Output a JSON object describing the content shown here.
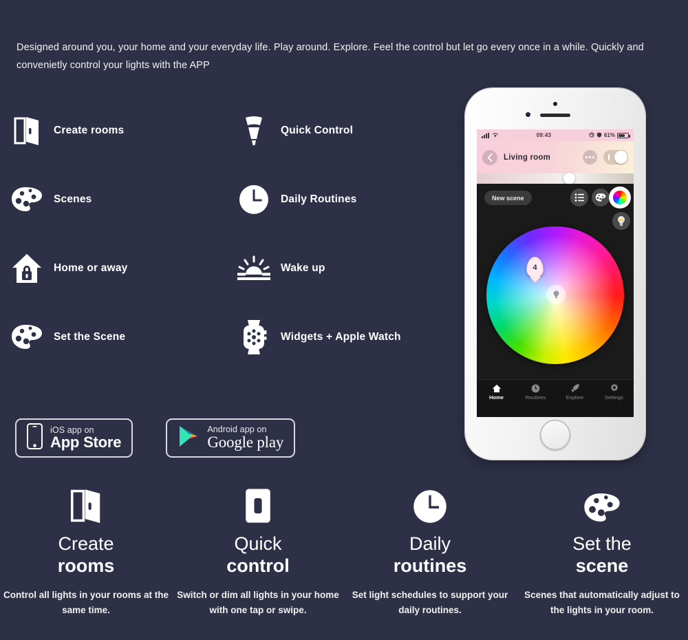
{
  "intro": {
    "text": "Designed around you, your home and your everyday life. Play around. Explore. Feel the control but let go every once in a while. Quickly and convenietly control your lights with the  APP"
  },
  "features": [
    {
      "icon": "open-door-icon",
      "label": "Create rooms"
    },
    {
      "icon": "spotlight-bulb-icon",
      "label": "Quick Control"
    },
    {
      "icon": "palette-icon",
      "label": "Scenes"
    },
    {
      "icon": "clock-icon",
      "label": "Daily Routines"
    },
    {
      "icon": "house-lock-icon",
      "label": "Home or away"
    },
    {
      "icon": "sunrise-icon",
      "label": "Wake up"
    },
    {
      "icon": "palette-icon",
      "label": "Set the Scene"
    },
    {
      "icon": "apple-watch-icon",
      "label": "Widgets + Apple Watch"
    }
  ],
  "badges": {
    "ios": {
      "icon": "iphone-icon",
      "small": "iOS app on",
      "big": "App Store"
    },
    "android": {
      "icon": "google-play-icon",
      "small": "Android app on",
      "big_bold": "Google",
      "big_light": " play"
    }
  },
  "bottom_features": [
    {
      "icon": "open-door-icon",
      "title_line1": "Create",
      "title_line2": "rooms",
      "desc": "Control all lights in your rooms at the same time."
    },
    {
      "icon": "light-switch-icon",
      "title_line1": "Quick",
      "title_line2": "control",
      "desc": "Switch or dim all lights in your home with one tap or swipe."
    },
    {
      "icon": "clock-icon",
      "title_line1": "Daily",
      "title_line2": "routines",
      "desc": "Set light schedules to support your daily routines."
    },
    {
      "icon": "palette-icon",
      "title_line1": "Set the",
      "title_line2": "scene",
      "desc": "Scenes that automatically adjust to the lights in your room."
    }
  ],
  "phone": {
    "status_bar": {
      "time": "09:43",
      "battery_percent": "61%",
      "icons": [
        "signal-bars-icon",
        "wifi-icon",
        "rotation-lock-icon",
        "alarm-icon",
        "battery-icon"
      ]
    },
    "header": {
      "back_icon": "chevron-left-icon",
      "room_name": "Living room",
      "more_icon": "more-dots-icon",
      "power_toggle": "on"
    },
    "brightness_slider": {
      "value_label": ""
    },
    "scene_button": "New scene",
    "right_buttons": [
      {
        "name": "list-view-button",
        "icon": "list-icon"
      },
      {
        "name": "palette-button",
        "icon": "palette-icon"
      },
      {
        "name": "color-wheel-button",
        "icon": "color-wheel-icon",
        "active": true
      },
      {
        "name": "bulb-button",
        "icon": "bulb-icon"
      }
    ],
    "color_wheel": {
      "lamp_pin_label": "4",
      "center_icon": "bulb-icon"
    },
    "tabs": [
      {
        "label": "Home",
        "icon": "home-icon",
        "active": true
      },
      {
        "label": "Routines",
        "icon": "clock-icon",
        "active": false
      },
      {
        "label": "Explore",
        "icon": "rocket-icon",
        "active": false
      },
      {
        "label": "Settings",
        "icon": "gear-icon",
        "active": false
      }
    ]
  },
  "colors": {
    "background": "#2e3047",
    "text": "#ffffff",
    "phone_body": "#f3f3f3",
    "app_background": "#1a1a1a",
    "header_pink": "#f9cfdd"
  }
}
